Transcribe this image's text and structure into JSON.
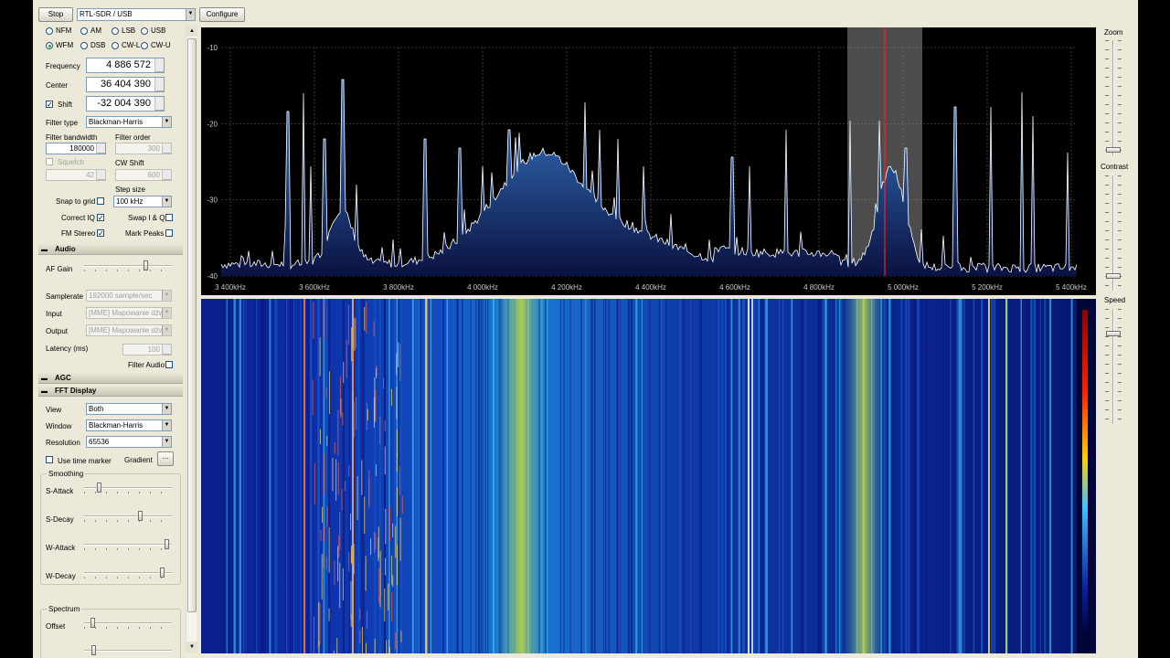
{
  "toolbar": {
    "stop_label": "Stop",
    "source_value": "RTL-SDR / USB",
    "configure_label": "Configure"
  },
  "radio": {
    "modes_row1": [
      "NFM",
      "AM",
      "LSB",
      "USB"
    ],
    "modes_row2": [
      "WFM",
      "DSB",
      "CW-L",
      "CW-U"
    ],
    "selected_mode": "WFM",
    "frequency_label": "Frequency",
    "frequency_value": "4 886 572",
    "center_label": "Center",
    "center_value": "36 404 390",
    "shift_label": "Shift",
    "shift_value": "-32 004 390",
    "shift_checked": true,
    "filter_type_label": "Filter type",
    "filter_type_value": "Blackman-Harris",
    "filter_bandwidth_label": "Filter bandwidth",
    "filter_bandwidth_value": "180000",
    "filter_order_label": "Filter order",
    "filter_order_value": "300",
    "squelch_label": "Squelch",
    "squelch_value": "42",
    "cw_shift_label": "CW Shift",
    "cw_shift_value": "600",
    "step_size_label": "Step size",
    "snap_label": "Snap to grid",
    "step_size_value": "100 kHz",
    "correct_iq_label": "Correct IQ",
    "swap_iq_label": "Swap I & Q",
    "fm_stereo_label": "FM Stereo",
    "mark_peaks_label": "Mark Peaks"
  },
  "audio": {
    "section_label": "Audio",
    "af_gain_label": "AF Gain",
    "af_gain_level": 0.72,
    "samplerate_label": "Samplerate",
    "samplerate_value": "192000 sample/sec",
    "input_label": "Input",
    "input_value": "[MME] Mapowanie dźwi",
    "output_label": "Output",
    "output_value": "[MME] Mapowanie dźwi",
    "latency_label": "Latency (ms)",
    "latency_value": "100",
    "filter_audio_label": "Filter Audio"
  },
  "agc": {
    "section_label": "AGC"
  },
  "fft": {
    "section_label": "FFT Display",
    "view_label": "View",
    "view_value": "Both",
    "window_label": "Window",
    "window_value": "Blackman-Harris",
    "resolution_label": "Resolution",
    "resolution_value": "65536",
    "time_marker_label": "Use  time marker",
    "gradient_label": "Gradient",
    "gradient_button": "...",
    "smoothing_label": "Smoothing",
    "s_attack_label": "S-Attack",
    "s_attack_level": 0.15,
    "s_decay_label": "S-Decay",
    "s_decay_level": 0.65,
    "w_attack_label": "W-Attack",
    "w_attack_level": 0.98,
    "w_decay_label": "W-Decay",
    "w_decay_level": 0.92,
    "spectrum_label": "Spectrum",
    "offset_label": "Offset",
    "offset_level": 0.08
  },
  "right_panel": {
    "zoom_label": "Zoom",
    "zoom_level": 0.02,
    "contrast_label": "Contrast",
    "contrast_level": 0.1,
    "speed_label": "Speed",
    "speed_level": 0.8
  },
  "spectrum": {
    "y_ticks": [
      "-10",
      "-20",
      "-30",
      "-40"
    ],
    "x_ticks": [
      "3 400kHz",
      "3 600kHz",
      "3 800kHz",
      "4 000kHz",
      "4 200kHz",
      "4 400kHz",
      "4 600kHz",
      "4 800kHz",
      "5 000kHz",
      "5 200kHz",
      "5 400kHz"
    ],
    "colors": {
      "background": "#000000",
      "trace": "#ffffff",
      "fill_top": "#3b7fd0",
      "fill_bottom": "#0a1240",
      "tuned_line": "#ff2020",
      "passband": "#8a8a8a"
    }
  }
}
